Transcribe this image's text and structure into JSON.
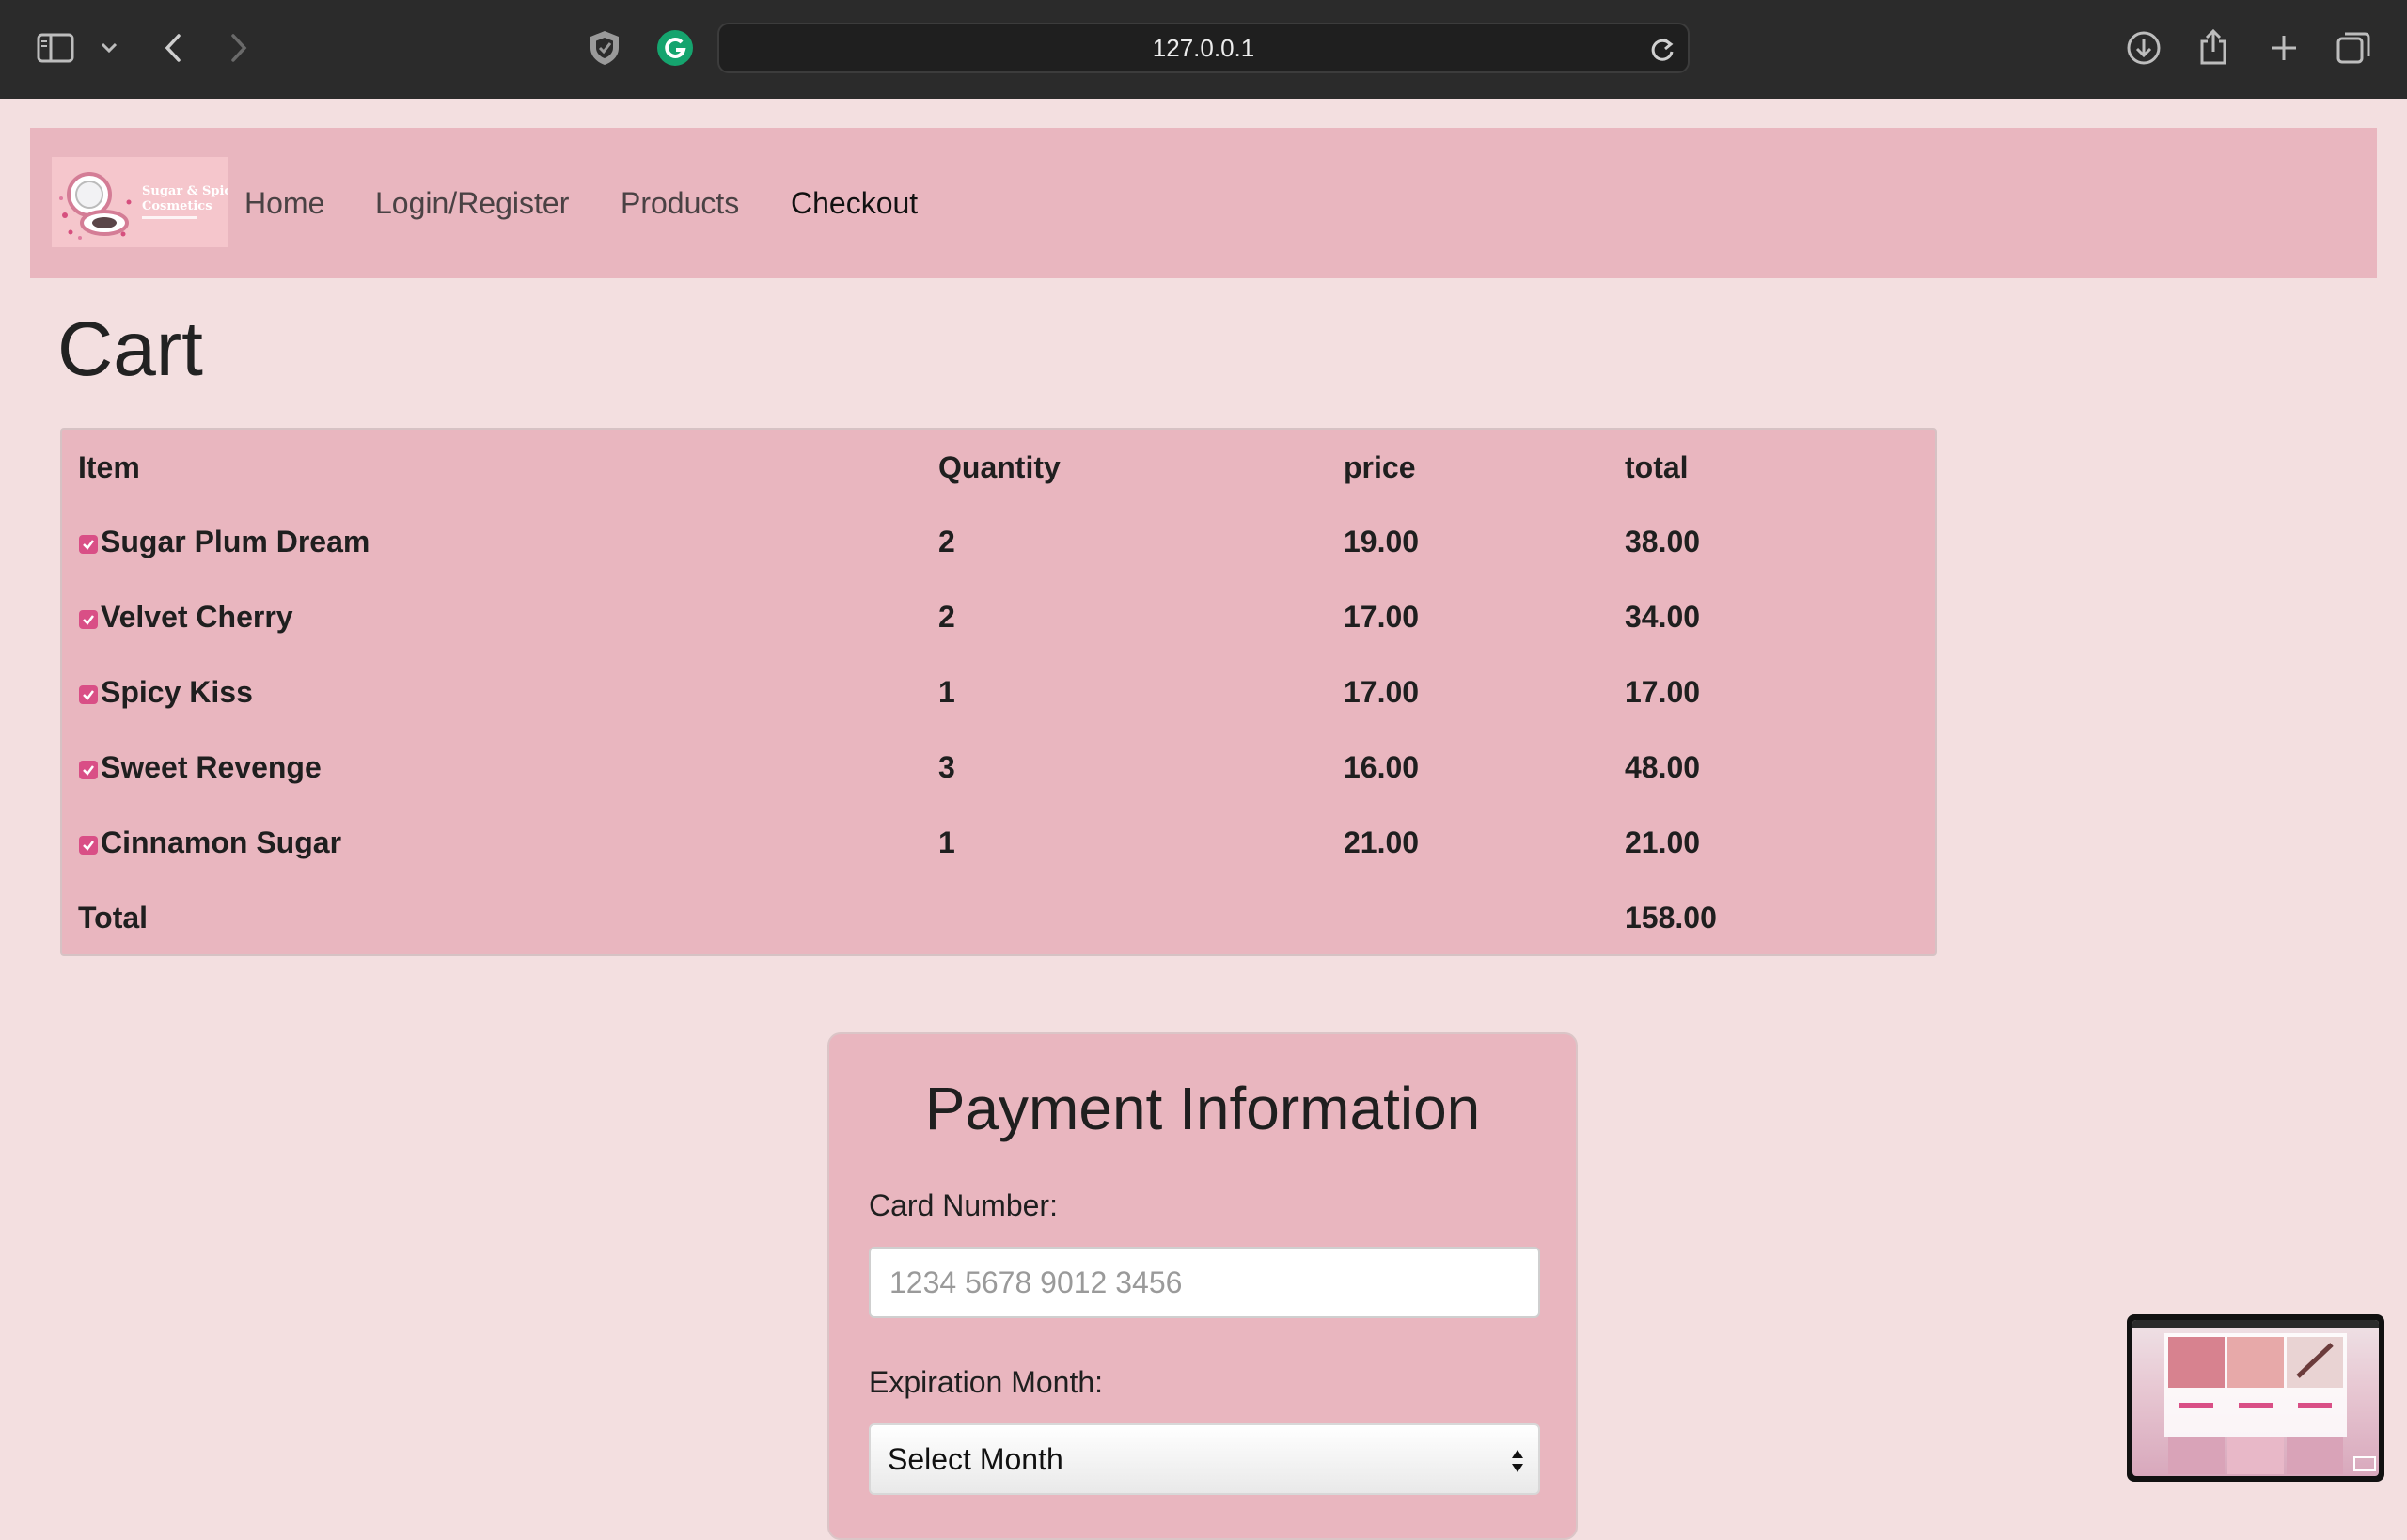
{
  "browser": {
    "url": "127.0.0.1",
    "icons": [
      "sidebar-icon",
      "chevron-down-icon",
      "back-arrow-icon",
      "forward-arrow-icon",
      "shield-icon",
      "grammarly-icon",
      "reload-icon",
      "download-icon",
      "share-icon",
      "new-tab-icon",
      "tabs-overview-icon"
    ]
  },
  "site": {
    "logo_text_line1": "Sugar & Spice",
    "logo_text_line2": "Cosmetics",
    "nav": {
      "home": "Home",
      "login": "Login/Register",
      "products": "Products",
      "checkout": "Checkout"
    }
  },
  "cart": {
    "title": "Cart",
    "headers": {
      "item": "Item",
      "quantity": "Quantity",
      "price": "price",
      "total": "total"
    },
    "rows": [
      {
        "item": "Sugar Plum Dream",
        "quantity": "2",
        "price": "19.00",
        "total": "38.00",
        "checked": true
      },
      {
        "item": "Velvet Cherry",
        "quantity": "2",
        "price": "17.00",
        "total": "34.00",
        "checked": true
      },
      {
        "item": "Spicy Kiss",
        "quantity": "1",
        "price": "17.00",
        "total": "17.00",
        "checked": true
      },
      {
        "item": "Sweet Revenge",
        "quantity": "3",
        "price": "16.00",
        "total": "48.00",
        "checked": true
      },
      {
        "item": "Cinnamon Sugar",
        "quantity": "1",
        "price": "21.00",
        "total": "21.00",
        "checked": true
      }
    ],
    "total_label": "Total",
    "grand_total": "158.00"
  },
  "payment": {
    "title": "Payment Information",
    "card_number_label": "Card Number:",
    "card_number_value": "",
    "card_number_placeholder": "1234 5678 9012 3456",
    "exp_month_label": "Expiration Month:",
    "exp_month_selected": "Select Month"
  },
  "colors": {
    "page_bg": "#f3dfe0",
    "panel_pink": "#e9b6bf",
    "checkbox_accent": "#d94f86",
    "chrome_bg": "#2b2b2b"
  }
}
